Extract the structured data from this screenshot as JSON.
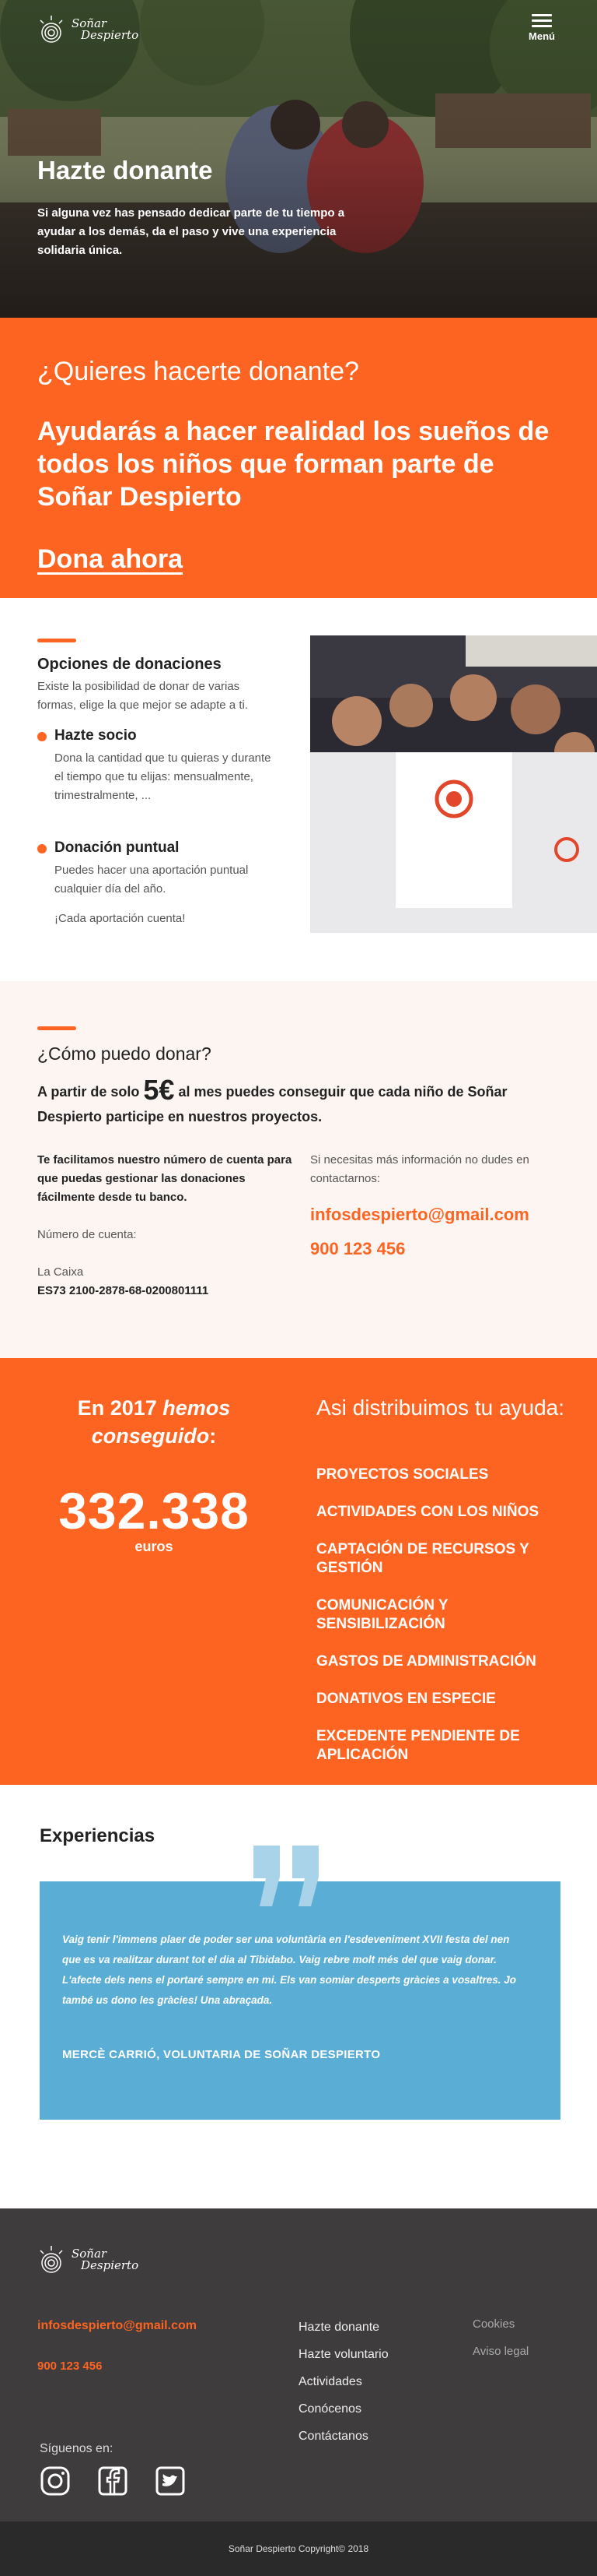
{
  "header": {
    "logo_line1": "Soñar",
    "logo_line2": "Despierto",
    "menu_label": "Menú"
  },
  "hero": {
    "title": "Hazte donante",
    "text": "Si alguna vez has pensado dedicar parte de tu tiempo a ayudar a los demás, da el paso y vive una experiencia solidaria única."
  },
  "cta": {
    "question": "¿Quieres hacerte donante?",
    "statement": "Ayudarás a hacer realidad los sueños de todos los niños que forman parte de Soñar Despierto",
    "link": "Dona ahora"
  },
  "options": {
    "title": "Opciones de donaciones",
    "intro": "Existe  la posibilidad de donar de varias formas, elige la que mejor se adapte a ti.",
    "items": [
      {
        "title": "Hazte socio",
        "text": "Dona la cantidad que tu quieras y durante el tiempo que tu elijas: mensualmente, trimestralmente, ..."
      },
      {
        "title": "Donación puntual",
        "text": "Puedes hacer una aportación puntual cualquier día del año."
      }
    ],
    "closing": "¡Cada aportación cuenta!",
    "photo_alt": "Voluntarios sosteniendo una camiseta"
  },
  "how": {
    "title": "¿Cómo puedo donar?",
    "lead_before": "A partir de solo",
    "lead_amount": "5€",
    "lead_after": "al mes puedes conseguir que cada niño de Soñar Despierto participe en nuestros proyectos.",
    "account_intro": "Te facilitamos nuestro número de cuenta para que puedas gestionar las donaciones fácilmente desde tu banco.",
    "account_label": "Número de cuenta:",
    "bank": "La Caixa",
    "iban": "ES73 2100-2878-68-0200801111",
    "contact_intro": "Si necesitas más información no dudes en contactarnos:",
    "email": "infosdespierto@gmail.com",
    "phone": "900 123 456"
  },
  "stats": {
    "year_prefix": "En 2017",
    "year_em": "hemos conseguido",
    "year_suffix": ":",
    "amount": "332.338",
    "unit": "euros",
    "dist_title": "Asi distribuimos tu ayuda:",
    "dist_items": [
      "PROYECTOS SOCIALES",
      "ACTIVIDADES CON LOS NIÑOS",
      "CAPTACIÓN DE RECURSOS Y GESTIÓN",
      "COMUNICACIÓN Y SENSIBILIZACIÓN",
      "GASTOS DE ADMINISTRACIÓN",
      "DONATIVOS EN ESPECIE",
      "EXCEDENTE PENDIENTE DE APLICACIÓN"
    ]
  },
  "experiences": {
    "title": "Experiencias",
    "quote": "Vaig tenir l'immens plaer de poder ser una voluntària en l'esdeveniment XVII festa del nen que es va realitzar durant tot el dia al Tibidabo. Vaig rebre molt més del que vaig donar. L'afecte dels nens el portaré sempre en mi. Els van somiar desperts gràcies a vosaltres. Jo també us dono les gràcies! Una abraçada.",
    "author": "MERCÈ CARRIÓ, VOLUNTARIA DE SOÑAR DESPIERTO"
  },
  "footer": {
    "email": "infosdespierto@gmail.com",
    "phone": "900 123 456",
    "follow": "Síguenos en:",
    "social": [
      "instagram-icon",
      "facebook-icon",
      "twitter-icon"
    ],
    "nav": [
      "Hazte donante",
      "Hazte voluntario",
      "Actividades",
      "Conócenos",
      "Contáctanos"
    ],
    "legal": [
      "Cookies",
      "Aviso legal"
    ],
    "copyright": "Soñar Despierto Copyright© 2018"
  },
  "colors": {
    "accent": "#fd6421",
    "quote_card": "#5aaed6",
    "footer_bg": "#3e3c3c"
  }
}
